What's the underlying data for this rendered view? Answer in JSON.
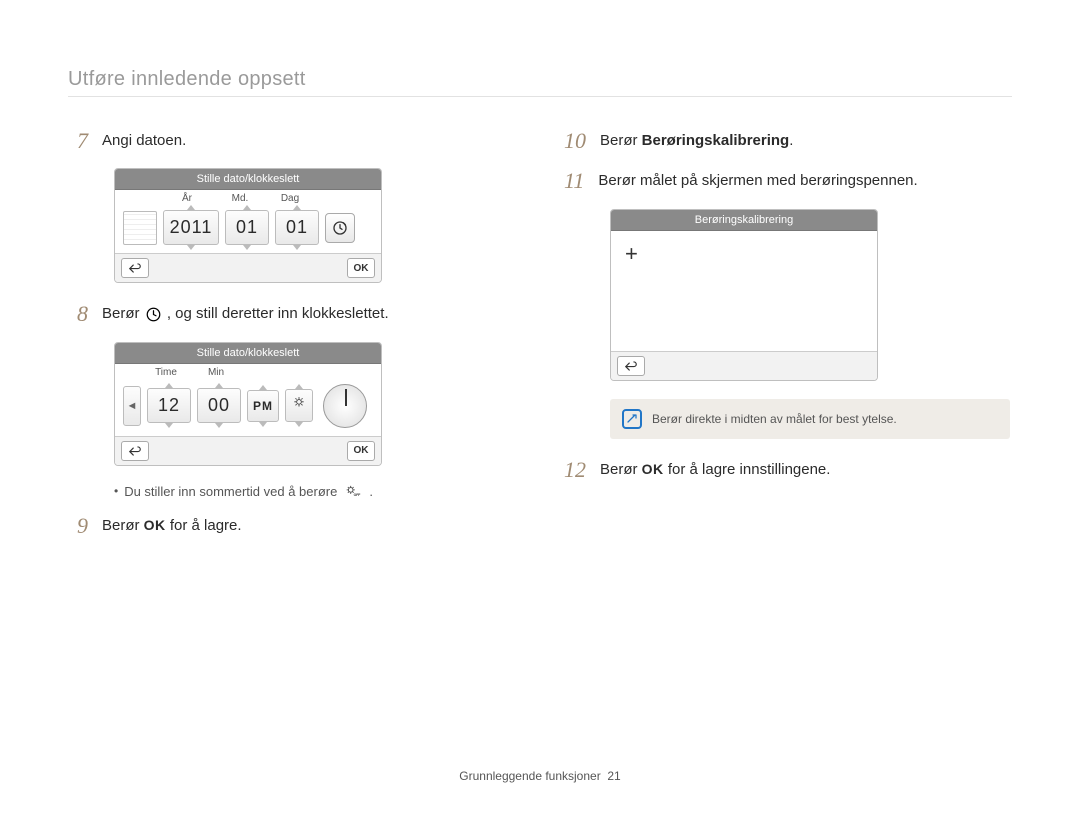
{
  "page": {
    "title": "Utføre innledende oppsett",
    "footer_label": "Grunnleggende funksjoner",
    "page_number": "21"
  },
  "left": {
    "step7": {
      "num": "7",
      "text": "Angi datoen."
    },
    "date_device": {
      "header": "Stille dato/klokkeslett",
      "labels": {
        "year": "År",
        "month": "Md.",
        "day": "Dag"
      },
      "values": {
        "year": "2011",
        "month": "01",
        "day": "01"
      },
      "ok": "OK"
    },
    "step8": {
      "num": "8",
      "text_before": "Berør ",
      "text_after": ", og still deretter inn klokkeslettet."
    },
    "time_device": {
      "header": "Stille dato/klokkeslett",
      "labels": {
        "time": "Time",
        "min": "Min"
      },
      "values": {
        "hour": "12",
        "min": "00",
        "ampm": "PM"
      },
      "ok": "OK"
    },
    "bullet": {
      "text_before": "Du stiller inn sommertid ved å berøre ",
      "text_after": "."
    },
    "step9": {
      "num": "9",
      "text_before": "Berør ",
      "ok_label": "OK",
      "text_after": " for å lagre."
    }
  },
  "right": {
    "step10": {
      "num": "10",
      "text_before": "Berør ",
      "bold": "Berøringskalibrering",
      "text_after": "."
    },
    "step11": {
      "num": "11",
      "text": "Berør målet på skjermen med berøringspennen."
    },
    "calib_device": {
      "header": "Berøringskalibrering"
    },
    "info": {
      "text": "Berør direkte i midten av målet for best ytelse."
    },
    "step12": {
      "num": "12",
      "text_before": "Berør ",
      "ok_label": "OK",
      "text_after": " for å lagre innstillingene."
    }
  },
  "chart_data": {
    "type": "table",
    "title": "Stille dato/klokkeslett",
    "date": {
      "År": 2011,
      "Md.": 1,
      "Dag": 1
    },
    "time": {
      "Time": 12,
      "Min": 0,
      "AMPM": "PM"
    }
  }
}
